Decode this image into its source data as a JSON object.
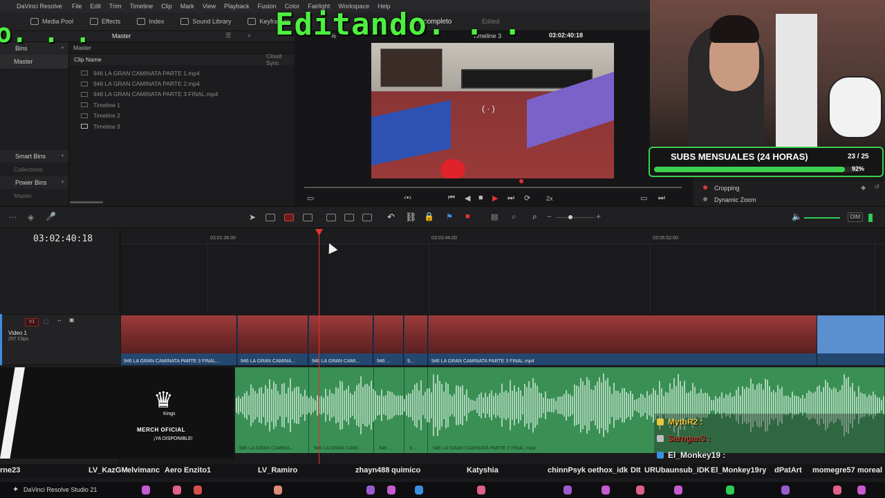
{
  "menubar": {
    "app_title": "DaVinci Resolve",
    "items": [
      "File",
      "Edit",
      "Trim",
      "Timeline",
      "Clip",
      "Mark",
      "View",
      "Playback",
      "Fusion",
      "Color",
      "Fairlight",
      "Workspace",
      "Help"
    ]
  },
  "toolbar": {
    "media_pool": "Media Pool",
    "effects": "Effects",
    "index": "Index",
    "sound_library": "Sound Library",
    "keyframes": "Keyframes",
    "completo": "k completo",
    "edited": "Edited"
  },
  "bins": {
    "header": "Bins",
    "master": "Master",
    "smart_bins": "Smart Bins",
    "collections": "Collections",
    "power_bins": "Power Bins",
    "power_master": "Master"
  },
  "cliplist": {
    "panel_label": "Master",
    "breadcrumb": "Master",
    "col_name": "Clip Name",
    "col_cloud": "Cloud Sync",
    "clips": [
      {
        "name": "946 LA GRAN CAMINATA PARTE 1.mp4",
        "kind": "video"
      },
      {
        "name": "946 LA GRAN CAMINATA PARTE 2.mp4",
        "kind": "video"
      },
      {
        "name": "946 LA GRAN CAMINATA PARTE 3 FINAL.mp4",
        "kind": "video"
      },
      {
        "name": "Timeline 1",
        "kind": "timeline"
      },
      {
        "name": "Timeline 2",
        "kind": "timeline"
      },
      {
        "name": "Timeline 3",
        "kind": "timeline"
      }
    ]
  },
  "viewer": {
    "zoom": "%",
    "timeline_name": "Timeline 3",
    "timecode": "03:02:40:18",
    "speed": "2x"
  },
  "inspector": {
    "cropping": "Cropping",
    "dynamic_zoom": "Dynamic Zoom"
  },
  "timeline": {
    "timecode": "03:02:40:18",
    "ruler": [
      "03:01:36:00",
      "03:03:44:00",
      "03:05:52:00"
    ],
    "track_label": "V1",
    "track_name": "Video 1",
    "track_clips": "257 Clips",
    "volume_label": "DIM",
    "video_clips": [
      {
        "label": "946 LA GRAN CAMINATA PARTE 3 FINAL..."
      },
      {
        "label": "946 LA GRAN CAMINA..."
      },
      {
        "label": "946 LA GRAN CAMI..."
      },
      {
        "label": "946 ..."
      },
      {
        "label": "9..."
      },
      {
        "label": "946 LA GRAN CAMINATA PARTE 3 FINAL.mp4"
      },
      {
        "label": ""
      }
    ],
    "audio_clips": [
      {
        "label": "946 LA GRAN CAMINA..."
      },
      {
        "label": "946 LA GRAN CAMI..."
      },
      {
        "label": "946 ..."
      },
      {
        "label": "9..."
      },
      {
        "label": "946 LA GRAN CAMINATA PARTE 3 FINAL.mp4"
      }
    ]
  },
  "overlay": {
    "title": "Editando. . .",
    "left_dots": "o. . .",
    "subs_title": "SUBS MENSUALES (24 HORAS)",
    "subs_count": "23 / 25",
    "subs_pct": "92%",
    "subs_progress": 0.92,
    "merch_kings": "Kings",
    "merch_title": "MERCH OFICIAL",
    "merch_sub": "¡YA DISPONIBLE!"
  },
  "chat": [
    {
      "name": "MythR2 :",
      "color": "#e8c53a",
      "badge": "#e8c53a"
    },
    {
      "name": "Sarngan3 :",
      "color": "#c0392b",
      "badge": "#bdbdbd"
    },
    {
      "name": "El_Monkey19 :",
      "color": "#f0f0f0",
      "badge": "#3a8fe0"
    }
  ],
  "names_bar": [
    "rne23",
    "LV_KazGM",
    "elvimanc",
    "Aero",
    "Enzito1",
    "LV_Ramiro",
    "zhayn488",
    "quimico",
    "Katyshia",
    "chinnPsyk",
    "oethox_idk",
    "DIt",
    "URUbaunsub_IDK",
    "El_Monkey19",
    "ry",
    "dPatArt",
    "momegre57",
    "moreal"
  ],
  "taskbar": {
    "app": "DaVinci Resolve Studio 21"
  }
}
